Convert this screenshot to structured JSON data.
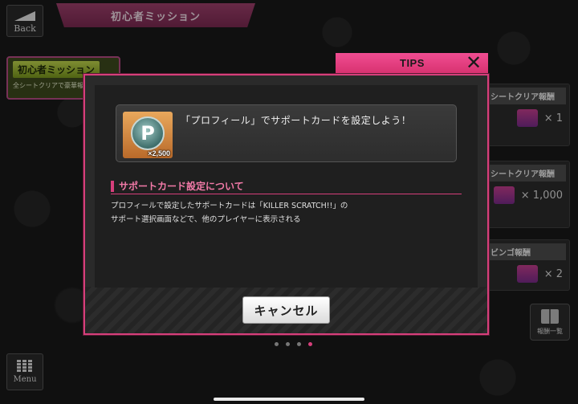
{
  "nav": {
    "back_label": "Back",
    "menu_label": "Menu",
    "reward_list_label": "報酬一覧"
  },
  "header": {
    "title": "初心者ミッション"
  },
  "mission_tab": {
    "title": "初心者ミッション",
    "subtitle": "全シートクリアで豪華報"
  },
  "right_cards": [
    {
      "heading": "シートクリア報酬",
      "amount": "× 1"
    },
    {
      "heading": "シートクリア報酬",
      "amount": "× 1,000"
    },
    {
      "heading": "ビンゴ報酬",
      "amount": "× 2"
    }
  ],
  "tips": {
    "title": "TIPS",
    "close_symbol": "✕",
    "mission": {
      "item_symbol": "P",
      "item_count": "×2,500",
      "text": "「プロフィール」でサポートカードを設定しよう！"
    },
    "section_title": "サポートカード設定について",
    "description_line1": "プロフィールで設定したサポートカードは「KILLER SCRATCH!!」の",
    "description_line2": "サポート選択画面などで、他のプレイヤーに表示される",
    "cancel_label": "キャンセル"
  },
  "pagination": {
    "total": 4,
    "active_index": 3
  },
  "colors": {
    "accent": "#d63f7b",
    "tips_header": "#f04d92",
    "section_title": "#f27aa8"
  }
}
